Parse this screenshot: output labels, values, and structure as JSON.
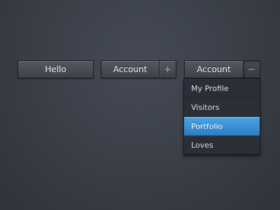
{
  "buttons": {
    "hello": {
      "label": "Hello"
    },
    "account_1": {
      "label": "Account",
      "toggle_icon": "plus-icon",
      "toggle_glyph": "+"
    },
    "account_2": {
      "label": "Account",
      "toggle_icon": "minus-icon",
      "toggle_glyph": "−"
    }
  },
  "dropdown": {
    "items": [
      {
        "label": "My Profile"
      },
      {
        "label": "Visitors"
      },
      {
        "label": "Portfolio"
      },
      {
        "label": "Loves"
      }
    ],
    "active_index": 2
  },
  "colors": {
    "background": "#3b4049",
    "button": "#4a4e57",
    "dropdown_bg": "#2b2e36",
    "highlight": "#3a8fd4"
  }
}
